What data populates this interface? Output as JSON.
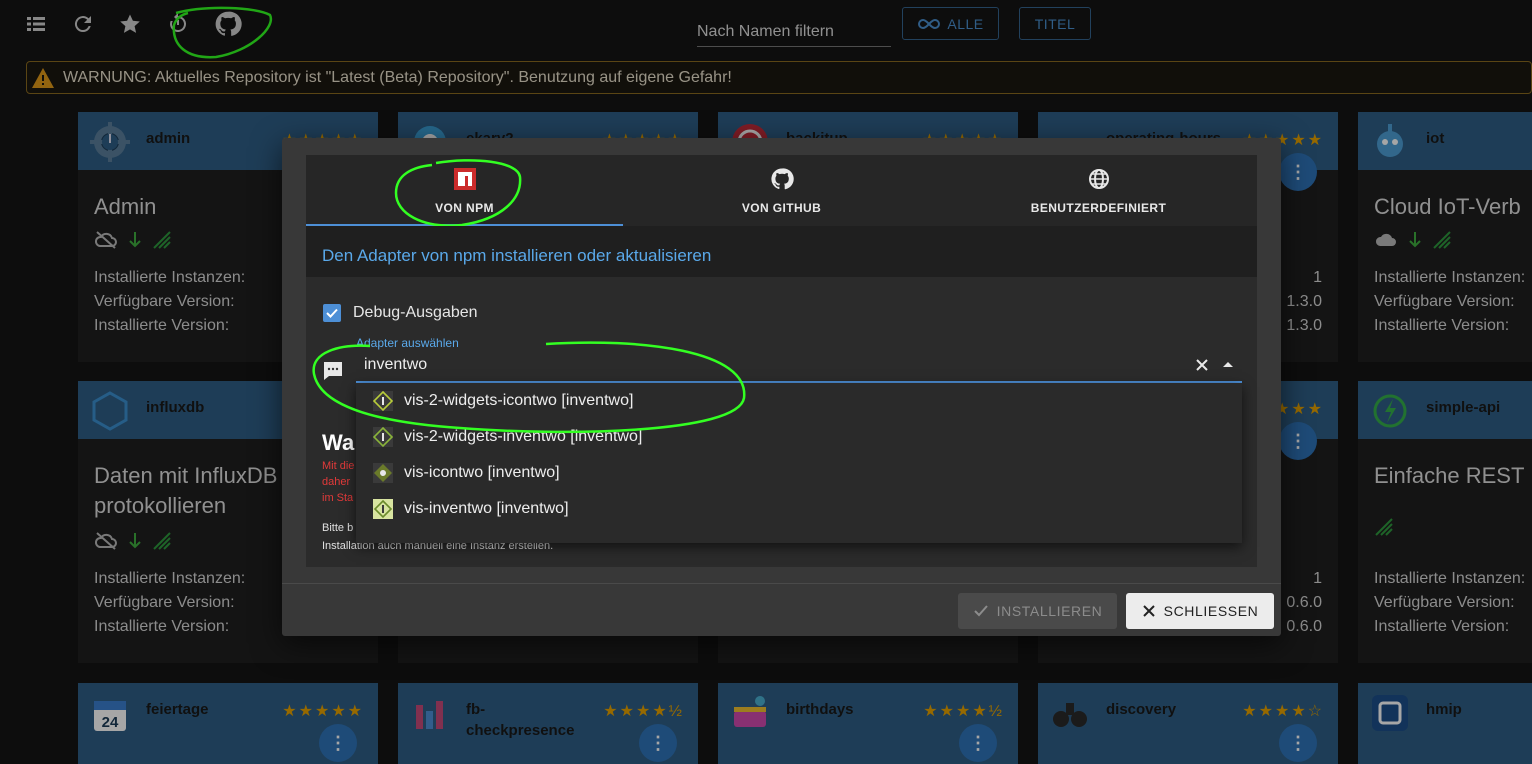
{
  "toolbar": {
    "filter_placeholder": "Nach Namen filtern",
    "btn_all": "ALLE",
    "btn_title": "TITEL"
  },
  "warning": {
    "text": "WARNUNG: Aktuelles Repository ist \"Latest (Beta) Repository\". Benutzung auf eigene Gefahr!"
  },
  "cards": {
    "admin": {
      "name": "admin",
      "title": "Admin",
      "inst_label": "Installierte Instanzen:",
      "avail_label": "Verfügbare Version:",
      "installed_label": "Installierte Version:"
    },
    "iot": {
      "name": "iot",
      "title": "Cloud IoT-Verb",
      "inst_label": "Installierte Instanzen:",
      "avail_label": "Verfügbare Version:",
      "installed_label": "Installierte Version:"
    },
    "influx": {
      "name": "influxdb",
      "title": "Daten mit InfluxDB",
      "title2": "protokollieren",
      "inst_label": "Installierte Instanzen:",
      "avail_label": "Verfügbare Version:",
      "installed_label": "Installierte Version:"
    },
    "simple": {
      "name": "simple-api",
      "title": "Einfache REST",
      "inst_label": "Installierte Instanzen:",
      "avail_label": "Verfügbare Version:",
      "installed_label": "Installierte Version:"
    },
    "col4_row1": {
      "inst": "1",
      "avail": "1.3.0",
      "installed": "1.3.0"
    },
    "col4_row2": {
      "inst": "1",
      "avail": "0.6.0",
      "installed": "0.6.0"
    },
    "partial1": "ekary2",
    "partial2": "backitup",
    "partial3": "operating-hours",
    "feiertage": "feiertage",
    "fb": "fb-",
    "fb2": "checkpresence",
    "birthdays": "birthdays",
    "discovery": "discovery",
    "hmip": "hmip",
    "fab_label": "⋮"
  },
  "dialog": {
    "tabs": [
      {
        "label": "VON NPM",
        "icon": "npm-icon"
      },
      {
        "label": "VON GITHUB",
        "icon": "github-icon"
      },
      {
        "label": "BENUTZERDEFINIERT",
        "icon": "globe-icon"
      }
    ],
    "header": "Den Adapter von npm installieren oder aktualisieren",
    "debug_label": "Debug-Ausgaben",
    "autocomplete_label": "Adapter auswählen",
    "autocomplete_value": "inventwo",
    "options": [
      "vis-2-widgets-icontwo [inventwo]",
      "vis-2-widgets-inventwo [inventwo]",
      "vis-icontwo [inventwo]",
      "vis-inventwo [inventwo]"
    ],
    "bg_heading": "Wa",
    "bg_red": [
      "Mit die",
      "daher",
      "im Sta"
    ],
    "bg_small1": "Bitte b",
    "bg_small2": "Installation auch manuell eine Instanz erstellen.",
    "btn_install": "INSTALLIEREN",
    "btn_close": "SCHLIESSEN"
  }
}
